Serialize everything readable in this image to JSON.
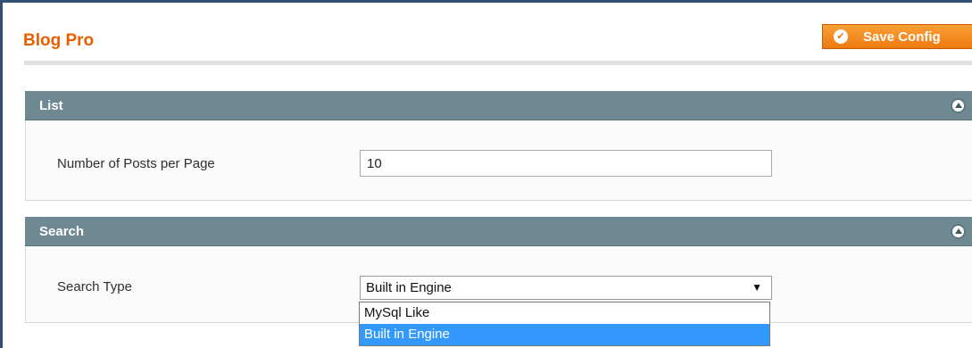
{
  "header": {
    "title": "Blog Pro",
    "save_label": "Save Config"
  },
  "sections": [
    {
      "title": "List",
      "fields": [
        {
          "label": "Number of Posts per Page",
          "value": "10"
        }
      ]
    },
    {
      "title": "Search",
      "fields": [
        {
          "label": "Search Type",
          "selected": "Built in Engine",
          "options": [
            "MySql Like",
            "Built in Engine"
          ]
        }
      ]
    }
  ],
  "colors": {
    "title": "#eb5e00",
    "save_button": "#ef7a12",
    "section_header": "#6f8992",
    "selected_option": "#3399ff"
  },
  "icons": {
    "save": "check-circle-icon",
    "collapse": "chevron-up-circle-icon",
    "select_arrow": "triangle-down-icon"
  }
}
